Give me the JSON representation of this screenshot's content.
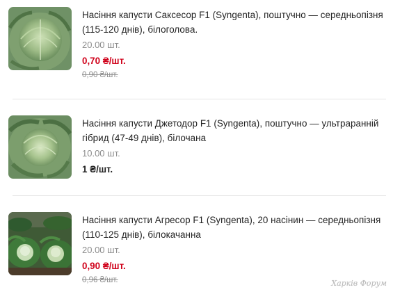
{
  "products": [
    {
      "image": "cabbage-head-icon",
      "title": "Насіння капусти Саксесор F1 (Syngenta), поштучно — середньопізня (115-120 днів), білоголова.",
      "quantity": "20.00 шт.",
      "price": "0,70 ₴/шт.",
      "old_price": "0,90 ₴/шт.",
      "on_sale": true
    },
    {
      "image": "cabbage-head-icon",
      "title": "Насіння капусти Джетодор F1 (Syngenta), поштучно — ультраранній гібрид (47-49 днів), білочана",
      "quantity": "10.00 шт.",
      "price": "1 ₴/шт.",
      "old_price": "",
      "on_sale": false
    },
    {
      "image": "cabbage-field-icon",
      "title": "Насіння капусти Агресор F1 (Syngenta), 20 насінин — середньопізня (110-125 днів), білокачанна",
      "quantity": "20.00 шт.",
      "price": "0,90 ₴/шт.",
      "old_price": "0,96 ₴/шт.",
      "on_sale": true
    }
  ],
  "watermark": "Харків Форум",
  "colors": {
    "sale_price": "#d0021b",
    "regular_price": "#222222",
    "muted": "#8d8d8d",
    "divider": "#e4e4e4"
  }
}
